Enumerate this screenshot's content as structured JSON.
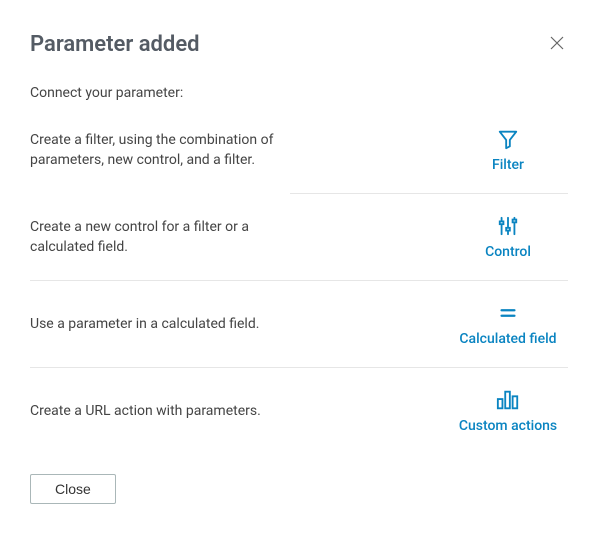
{
  "title": "Parameter added",
  "subtitle": "Connect your parameter:",
  "options": [
    {
      "desc": "Create a filter, using the combination of parameters, new control, and a filter.",
      "label": "Filter"
    },
    {
      "desc": "Create a new control for a filter or a calculated field.",
      "label": "Control"
    },
    {
      "desc": "Use a parameter in a calculated field.",
      "label": "Calculated field"
    },
    {
      "desc": "Create a URL action with parameters.",
      "label": "Custom actions"
    }
  ],
  "close_button": "Close",
  "accent": "#0a84c1"
}
